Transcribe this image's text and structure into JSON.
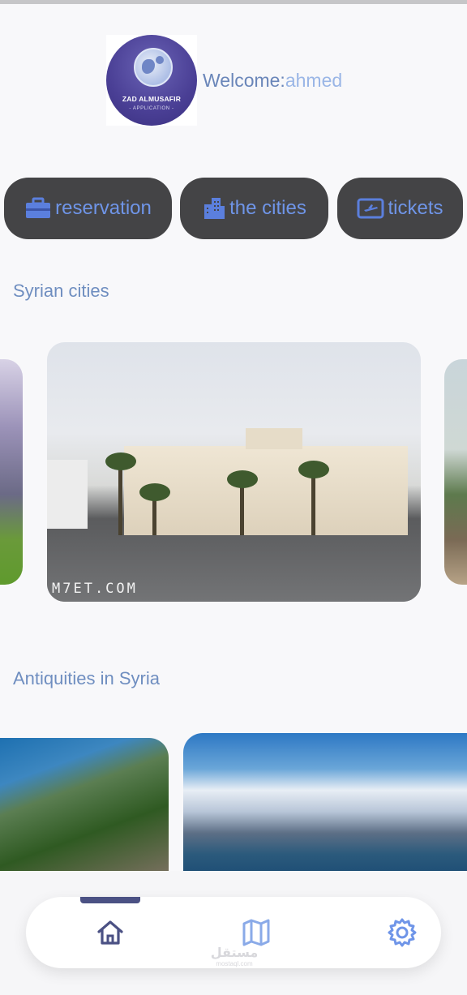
{
  "header": {
    "logo": {
      "title": "ZAD ALMUSAFIR",
      "subtitle": "- APPLICATION -"
    },
    "welcome_label": "Welcome:",
    "username": "ahmed"
  },
  "quick_actions": [
    {
      "label": "reservation",
      "icon": "briefcase-icon"
    },
    {
      "label": "the cities",
      "icon": "buildings-icon"
    },
    {
      "label": "tickets",
      "icon": "ticket-plane-icon"
    }
  ],
  "sections": {
    "cities_title": "Syrian cities",
    "cities_watermark": "M7ET.COM",
    "antiquities_title": "Antiquities in Syria"
  },
  "bottom_nav": {
    "items": [
      "home-icon",
      "map-icon",
      "settings-icon"
    ],
    "active": "home-icon",
    "brand": {
      "arabic": "مستقل",
      "latin": "mostaql.com"
    }
  },
  "colors": {
    "button_bg": "#444446",
    "accent_text": "#6f95e8",
    "section_title": "#6f8ec0",
    "nav_active": "#4b5184"
  }
}
